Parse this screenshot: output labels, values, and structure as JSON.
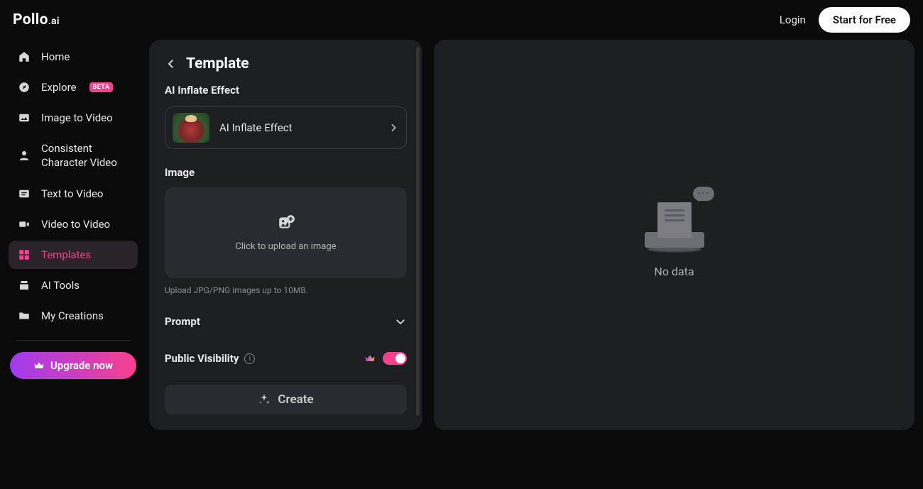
{
  "logo": {
    "primary": "Pollo",
    "secondary": ".ai"
  },
  "header": {
    "login": "Login",
    "start_for_free": "Start for Free"
  },
  "sidebar": {
    "items": [
      {
        "label": "Home"
      },
      {
        "label": "Explore",
        "badge": "BETA"
      },
      {
        "label": "Image to Video"
      },
      {
        "label": "Consistent Character Video"
      },
      {
        "label": "Text to Video"
      },
      {
        "label": "Video to Video"
      },
      {
        "label": "Templates"
      },
      {
        "label": "AI Tools"
      },
      {
        "label": "My Creations"
      }
    ],
    "upgrade_label": "Upgrade now"
  },
  "settings": {
    "page_title": "Template",
    "effect_section_label": "AI Inflate Effect",
    "effect_name": "AI Inflate Effect",
    "image_section_label": "Image",
    "upload_text": "Click to upload an image",
    "upload_hint": "Upload JPG/PNG images up to 10MB.",
    "prompt_label": "Prompt",
    "visibility_label": "Public Visibility",
    "create_label": "Create"
  },
  "output": {
    "empty_text": "No data"
  }
}
